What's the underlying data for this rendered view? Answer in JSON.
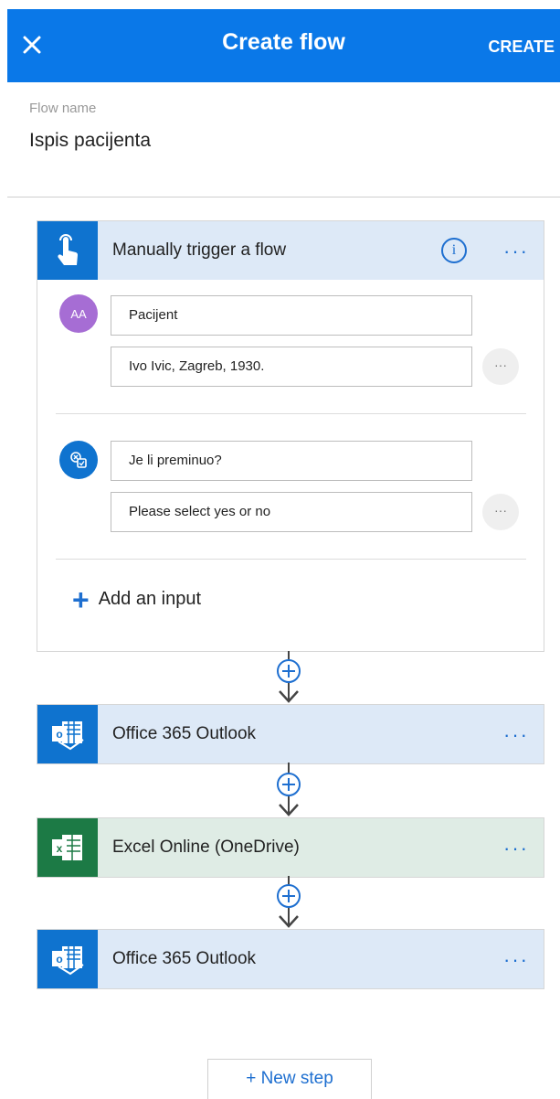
{
  "header": {
    "title": "Create flow",
    "action_label": "CREATE"
  },
  "flow": {
    "name_label": "Flow name",
    "name_value": "Ispis pacijenta"
  },
  "trigger": {
    "label": "Manually trigger a flow",
    "inputs": [
      {
        "avatar_text": "AA",
        "title": "Pacijent",
        "value": "Ivo Ivic, Zagreb, 1930.",
        "more": "···"
      },
      {
        "title": "Je li preminuo?",
        "value": "Please select yes or no",
        "more": "···"
      }
    ],
    "add_input_label": "Add an input"
  },
  "steps": [
    {
      "label": "Office 365 Outlook",
      "color": "#0f73cf"
    },
    {
      "label": "Excel Online (OneDrive)",
      "color": "#1c7a45"
    },
    {
      "label": "Office 365 Outlook",
      "color": "#0f73cf"
    }
  ],
  "more_label": "···",
  "new_step_label": "+ New step",
  "colors": {
    "accent": "#0a78e8",
    "link": "#1e6fd0",
    "header_bg": "#dde9f7",
    "excel_bg": "#dfece5"
  }
}
